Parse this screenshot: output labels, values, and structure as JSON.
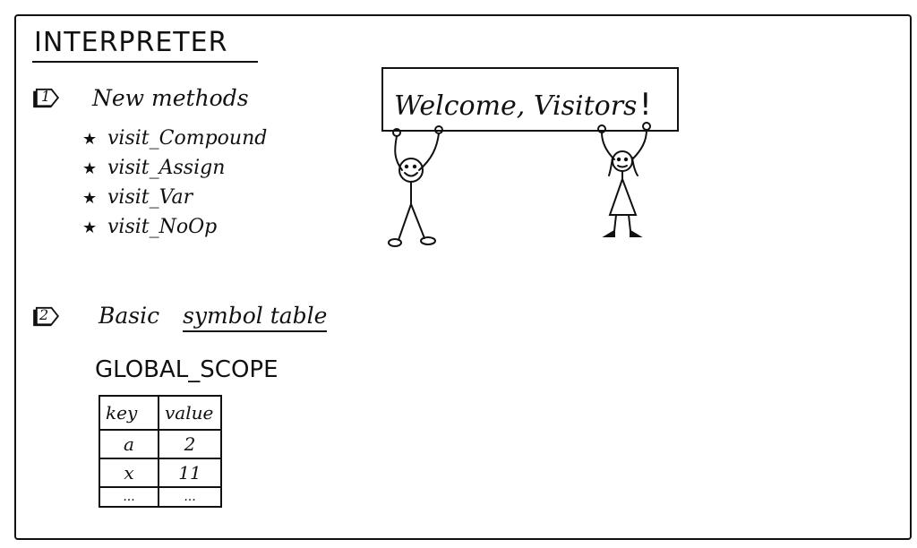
{
  "title": "INTERPRETER",
  "section1": {
    "number": "1",
    "heading": "New methods",
    "methods": [
      {
        "name": "visit_Compound",
        "icon": "star-icon"
      },
      {
        "name": "visit_Assign",
        "icon": "star-icon"
      },
      {
        "name": "visit_Var",
        "icon": "star-icon"
      },
      {
        "name": "visit_NoOp",
        "icon": "star-icon"
      }
    ]
  },
  "section2": {
    "number": "2",
    "heading_prefix": "Basic",
    "heading_underlined": "symbol table",
    "scope_name": "GLOBAL_SCOPE",
    "table": {
      "headers": [
        "key",
        "value"
      ],
      "rows": [
        [
          "a",
          "2"
        ],
        [
          "x",
          "11"
        ],
        [
          "...",
          "..."
        ]
      ]
    }
  },
  "banner": {
    "text": "Welcome, Visitors",
    "exclamation": "!"
  }
}
